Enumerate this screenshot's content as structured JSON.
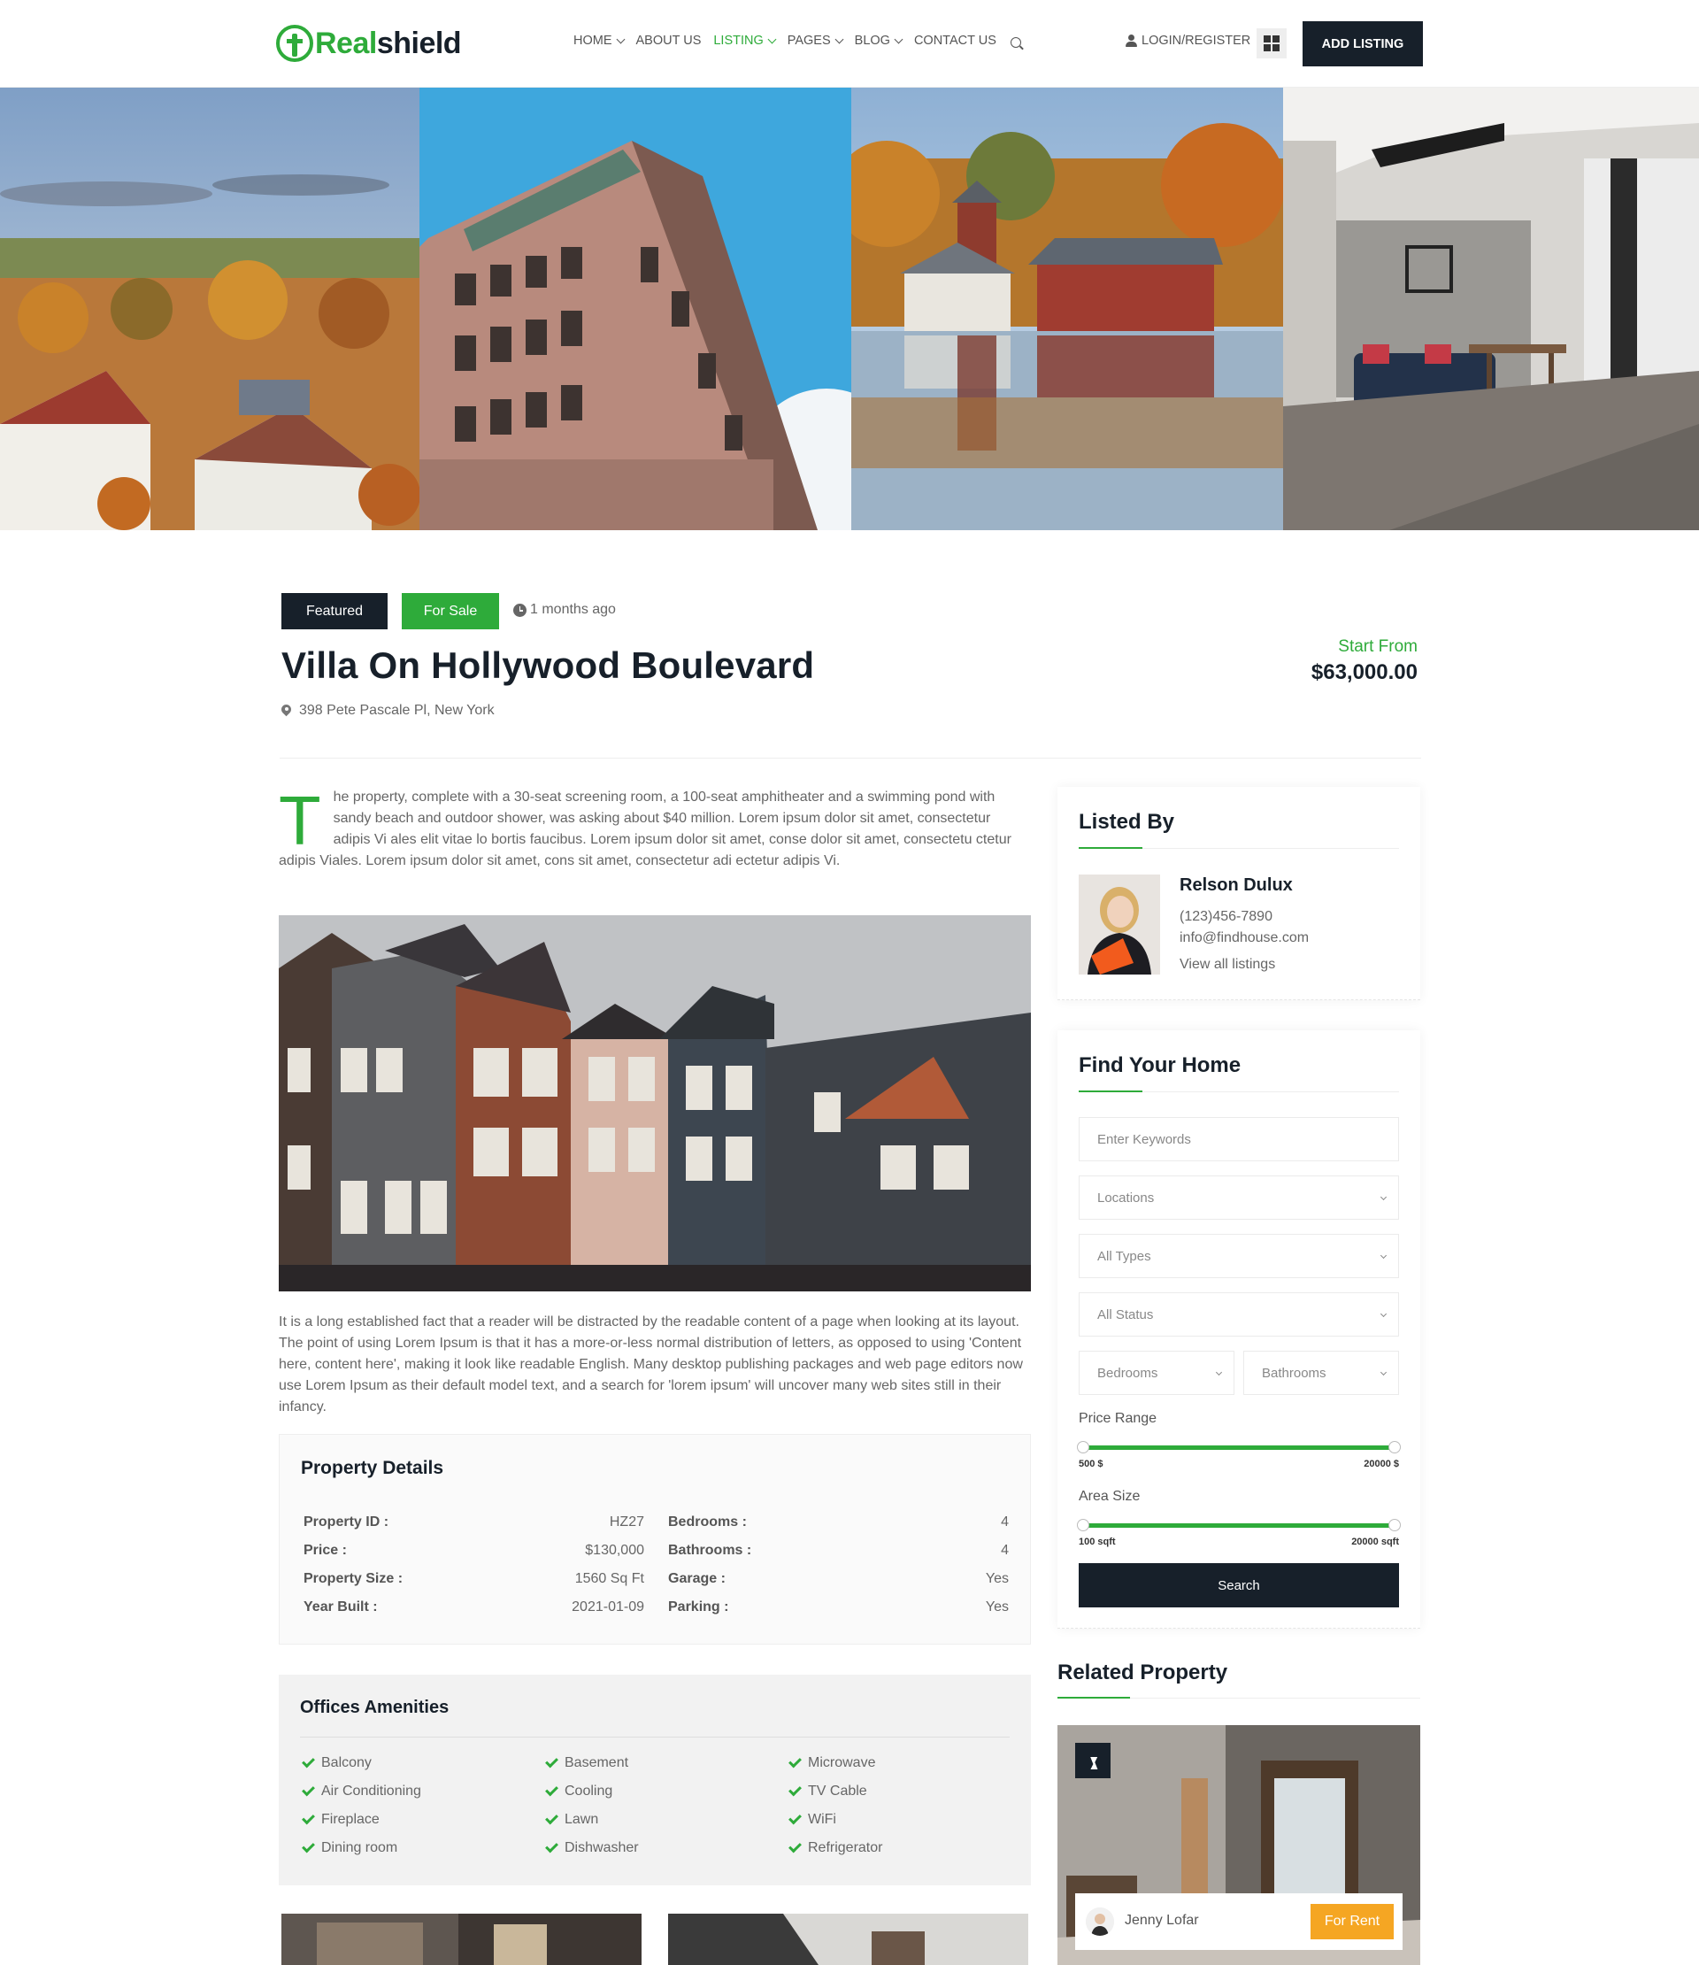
{
  "brand": {
    "logo_green": "Real",
    "logo_dark": "shield",
    "accent": "#2eab3a",
    "dark": "#17202a"
  },
  "nav": {
    "items": [
      {
        "label": "HOME",
        "dropdown": true,
        "active": false
      },
      {
        "label": "ABOUT US",
        "dropdown": false,
        "active": false
      },
      {
        "label": "LISTING",
        "dropdown": true,
        "active": true
      },
      {
        "label": "PAGES",
        "dropdown": true,
        "active": false
      },
      {
        "label": "BLOG",
        "dropdown": true,
        "active": false
      },
      {
        "label": "CONTACT US",
        "dropdown": false,
        "active": false
      }
    ],
    "login": "LOGIN/REGISTER",
    "add_listing": "ADD LISTING"
  },
  "property": {
    "badges": {
      "featured": "Featured",
      "status": "For Sale"
    },
    "posted": "1 months ago",
    "title": "Villa On Hollywood Boulevard",
    "address": "398 Pete Pascale Pl, New York",
    "price_label": "Start From",
    "price": "$63,000.00",
    "dropcap": "T",
    "description_1": "he property, complete with a 30-seat screening room, a 100-seat amphitheater and a swimming pond with sandy beach and outdoor shower, was asking about $40 million. Lorem ipsum dolor sit amet, consectetur adipis Vi ales elit vitae lo bortis faucibus. Lorem ipsum dolor sit amet, conse dolor sit amet, consectetu ctetur adipis Viales. Lorem ipsum dolor sit amet, cons sit amet, consectetur adi ectetur adipis Vi.",
    "description_2": "It is a long established fact that a reader will be distracted by the readable content of a page when looking at its layout. The point of using Lorem Ipsum is that it has a more-or-less normal distribution of letters, as opposed to using 'Content here, content here', making it look like readable English. Many desktop publishing packages and web page editors now use Lorem Ipsum as their default model text, and a search for 'lorem ipsum' will uncover many web sites still in their infancy."
  },
  "details": {
    "title": "Property Details",
    "left": [
      {
        "label": "Property ID :",
        "value": "HZ27"
      },
      {
        "label": "Price :",
        "value": "$130,000"
      },
      {
        "label": "Property Size :",
        "value": "1560 Sq Ft"
      },
      {
        "label": "Year Built :",
        "value": "2021-01-09"
      }
    ],
    "right": [
      {
        "label": "Bedrooms :",
        "value": "4"
      },
      {
        "label": "Bathrooms :",
        "value": "4"
      },
      {
        "label": "Garage :",
        "value": "Yes"
      },
      {
        "label": "Parking :",
        "value": "Yes"
      }
    ]
  },
  "amenities": {
    "title": "Offices Amenities",
    "items": [
      [
        "Balcony",
        "Air Conditioning",
        "Fireplace",
        "Dining room"
      ],
      [
        "Basement",
        "Cooling",
        "Lawn",
        "Dishwasher"
      ],
      [
        "Microwave",
        "TV Cable",
        "WiFi",
        "Refrigerator"
      ]
    ]
  },
  "listed_by": {
    "title": "Listed By",
    "name": "Relson Dulux",
    "phone": "(123)456-7890",
    "email": "info@findhouse.com",
    "link": "View all listings"
  },
  "search": {
    "title": "Find Your Home",
    "keywords_placeholder": "Enter Keywords",
    "locations": "Locations",
    "types": "All Types",
    "status": "All Status",
    "bedrooms": "Bedrooms",
    "bathrooms": "Bathrooms",
    "price_range_label": "Price Range",
    "price_min": "500 $",
    "price_max": "20000 $",
    "area_label": "Area Size",
    "area_min": "100 sqft",
    "area_max": "20000 sqft",
    "button": "Search"
  },
  "related": {
    "title": "Related Property",
    "agent": "Jenny Lofar",
    "status": "For Rent",
    "status_color": "#f5a623"
  }
}
